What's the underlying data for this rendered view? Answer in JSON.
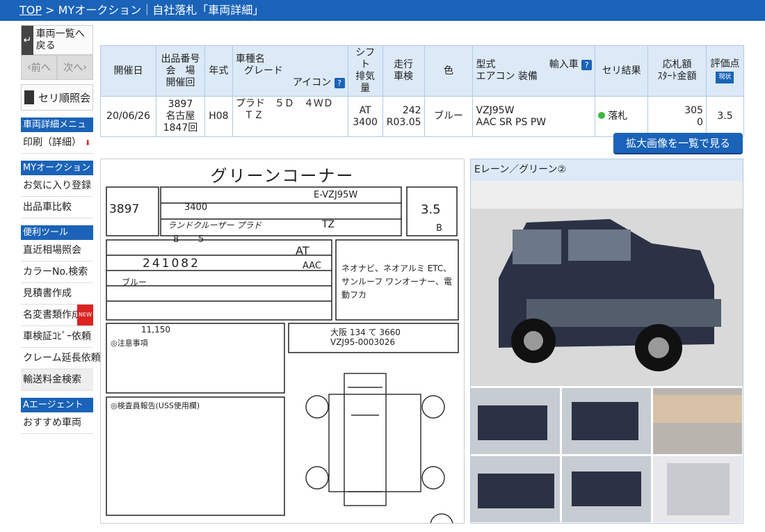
{
  "breadcrumb": {
    "top": "TOP",
    "sep": ">",
    "rest": "MYオークション｜自社落札「車両詳細」"
  },
  "sidebar": {
    "back": "車両一覧へ戻る",
    "prev": "前へ",
    "next": "次へ",
    "seri": "セリ順照会",
    "menu_head": "車両詳細メニュー",
    "print": "印刷（詳細）",
    "my_head": "MYオークション",
    "fav": "お気に入り登録",
    "compare": "出品車比較",
    "tools_head": "便利ツール",
    "tools": [
      "直近相場照会",
      "カラーNo.検索",
      "見積書作成",
      "名変書類作成",
      "車検証ｺﾋﾟｰ依頼",
      "クレーム延長依頼",
      "輸送料金検索"
    ],
    "agent_head": "Aエージェント",
    "agent_item": "おすすめ車両",
    "new_badge": "NEW"
  },
  "table": {
    "headers": {
      "date": "開催日",
      "lot": [
        "出品番号",
        "会　場",
        "開催回"
      ],
      "year": "年式",
      "model": [
        "車種名",
        "グレード",
        "アイコン"
      ],
      "shift": [
        "シフト",
        "排気量"
      ],
      "mileage": [
        "走行",
        "車検"
      ],
      "color": "色",
      "type": [
        "型式",
        "輸入車",
        "エアコン 装備"
      ],
      "result": "セリ結果",
      "price": [
        "応札額",
        "ｽﾀｰﾄ金額"
      ],
      "score": "評価点",
      "score_badge": "現状"
    },
    "row": {
      "date": "20/06/26",
      "lot": [
        "3897",
        "名古屋",
        "1847回"
      ],
      "year": "H08",
      "model": [
        "プラド　５Ｄ　４ＷＤ",
        "ＴＺ"
      ],
      "shift": [
        "AT",
        "3400"
      ],
      "mileage": [
        "242",
        "R03.05"
      ],
      "color": "ブルー",
      "type": [
        "VZJ95W",
        "AAC SR PS PW"
      ],
      "result": "落札",
      "price": [
        "305",
        "0"
      ],
      "score": "3.5"
    }
  },
  "enlarge_button": "拡大画像を一覧で見る",
  "sheet": {
    "title": "グリーンコーナー",
    "lot": "3897",
    "year": "8",
    "month": "5",
    "model": "ランドクルーザー プラド",
    "displacement": "3400",
    "type": "E-VZJ95W",
    "grade": "TZ",
    "score": "3.5",
    "interior": "B",
    "mileage": "241082",
    "shift": "AT",
    "ac": "AAC",
    "color": "ブルー",
    "recycle": "11,150",
    "sales_points": "ネオナビ、ネオアルミ ETC、サンルーフ ワンオーナー、電動フカ",
    "plate": "大阪 134 て 3660",
    "serial": "VZJ95-0003026",
    "notes_head": "◎注意事項",
    "report_head": "◎検査員報告(USS使用欄)"
  },
  "photos": {
    "heading": "Eレーン／グリーン②"
  },
  "colors": {
    "accent": "#1a63b8",
    "header_bg": "#dce9f7",
    "result_dot": "#3cb73c"
  }
}
